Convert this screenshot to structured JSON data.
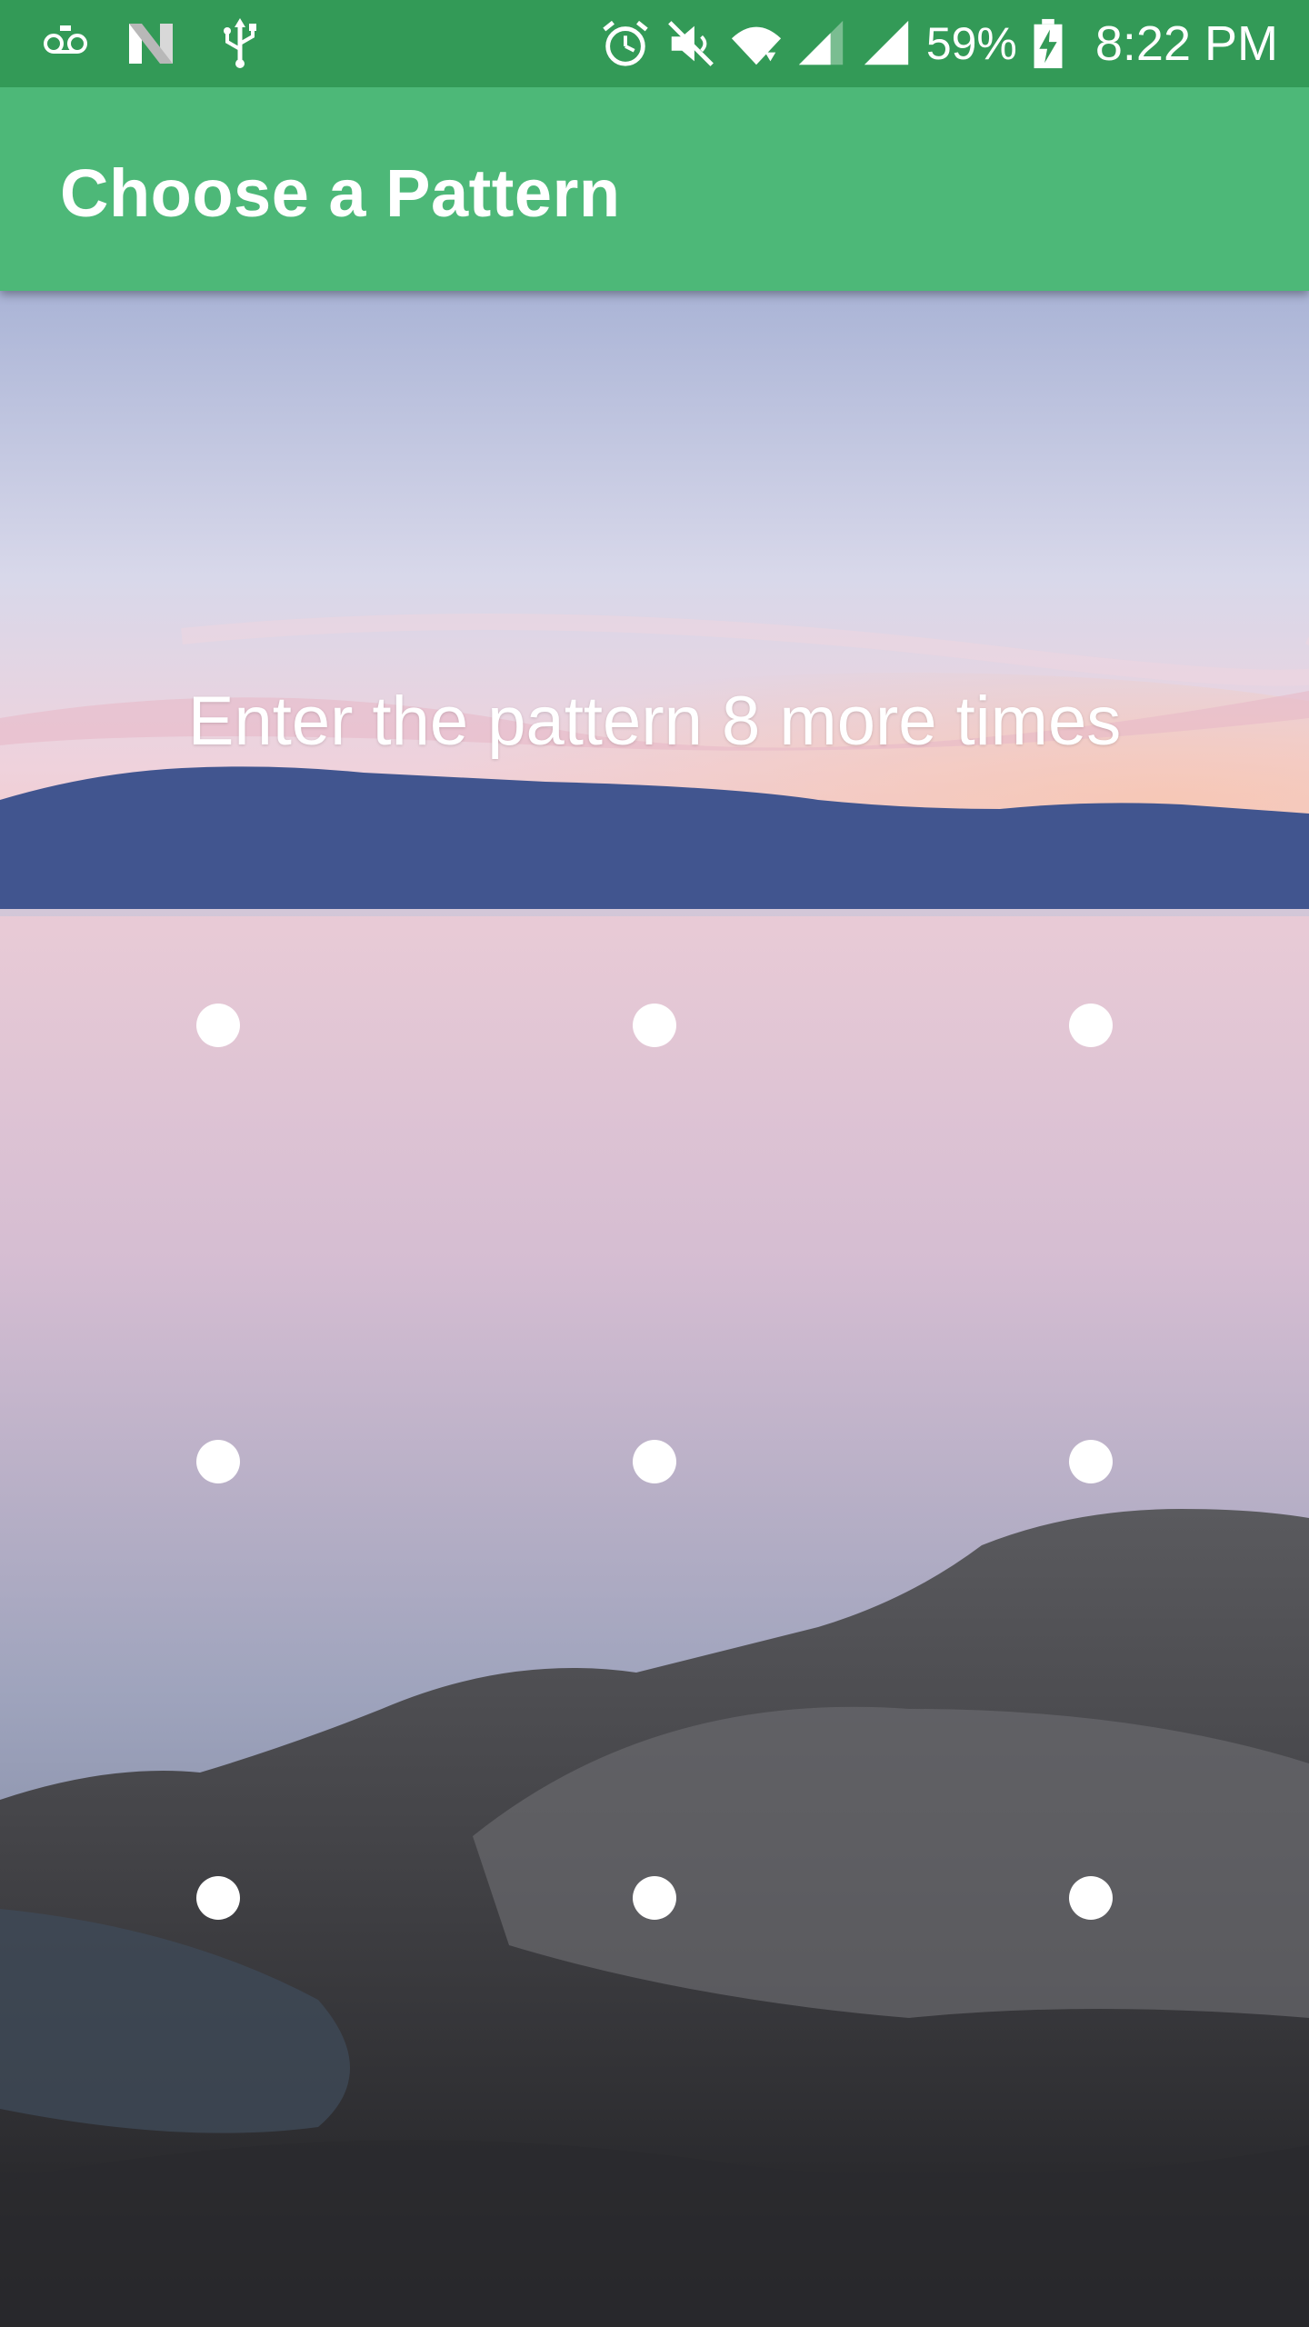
{
  "status_bar": {
    "left_icons": [
      "voicemail-icon",
      "n-logo-icon",
      "usb-icon"
    ],
    "right_icons": [
      "alarm-icon",
      "mute-icon",
      "wifi-icon",
      "signal-icon",
      "signal-icon",
      "battery-charging-icon"
    ],
    "battery_percent": "59%",
    "time": "8:22 PM",
    "color": "#339a57"
  },
  "app_bar": {
    "title": "Choose a Pattern",
    "color": "#4db878"
  },
  "prompt": "Enter the pattern 8 more times",
  "pattern_grid": {
    "rows": 3,
    "cols": 3,
    "dot_color": "#ffffff"
  }
}
